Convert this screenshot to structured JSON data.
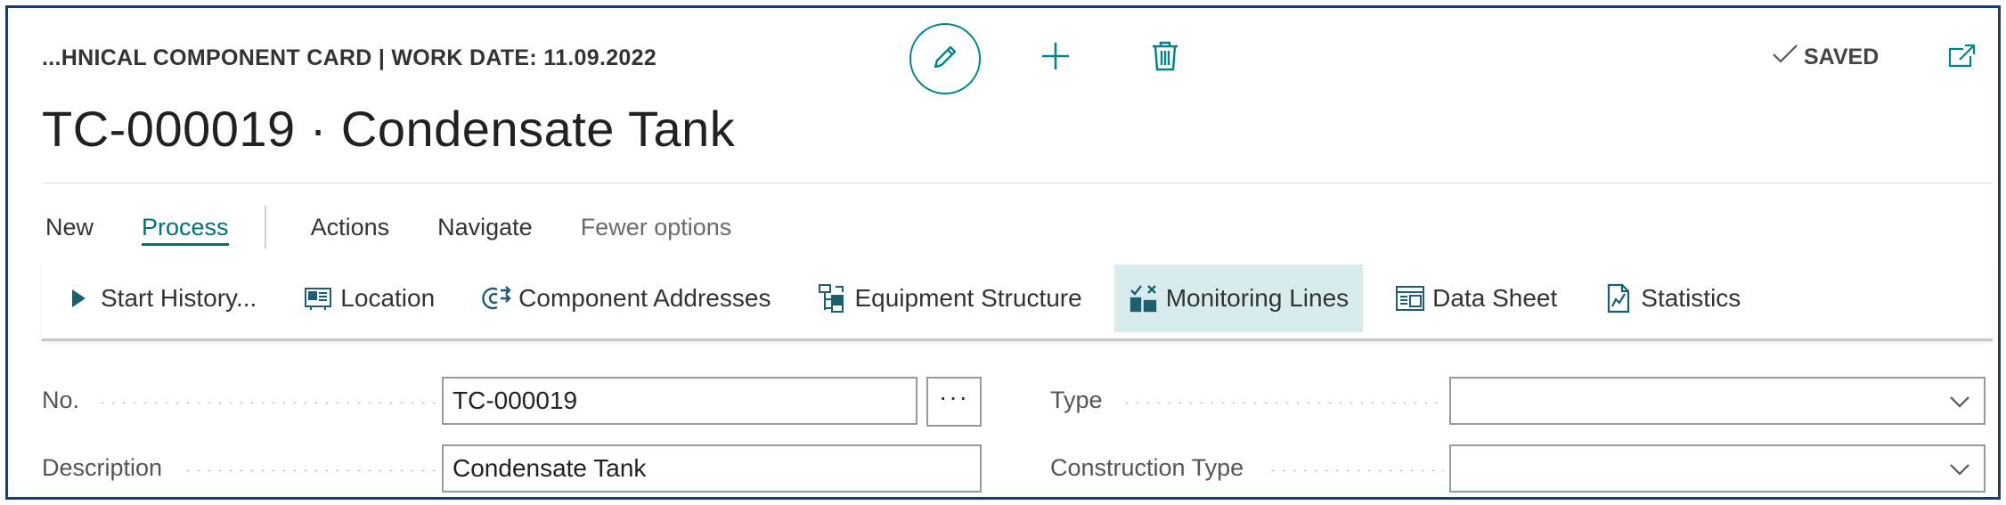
{
  "header": {
    "caption": "...HNICAL COMPONENT CARD | WORK DATE: 11.09.2022",
    "title": "TC-000019 · Condensate Tank",
    "saved_label": "SAVED"
  },
  "icons": {
    "edit": "pencil-icon",
    "new": "plus-icon",
    "delete": "trash-icon",
    "saved": "checkmark-icon",
    "popout": "open-in-new-window-icon"
  },
  "menu": {
    "items": [
      {
        "label": "New"
      },
      {
        "label": "Process"
      },
      {
        "label": "Actions"
      },
      {
        "label": "Navigate"
      },
      {
        "label": "Fewer options"
      }
    ]
  },
  "subbar": {
    "items": [
      {
        "label": "Start History...",
        "icon": "play-icon"
      },
      {
        "label": "Location",
        "icon": "location-card-icon"
      },
      {
        "label": "Component Addresses",
        "icon": "addresses-icon"
      },
      {
        "label": "Equipment Structure",
        "icon": "structure-icon"
      },
      {
        "label": "Monitoring Lines",
        "icon": "monitoring-lines-icon"
      },
      {
        "label": "Data Sheet",
        "icon": "data-sheet-icon"
      },
      {
        "label": "Statistics",
        "icon": "statistics-icon"
      }
    ]
  },
  "form": {
    "no_label": "No.",
    "no_value": "TC-000019",
    "lookup_label": "···",
    "description_label": "Description",
    "description_value": "Condensate Tank",
    "type_label": "Type",
    "type_value": "",
    "construction_type_label": "Construction Type",
    "construction_type_value": ""
  },
  "colors": {
    "accent": "#00707a",
    "highlight": "#d8ecee",
    "frame": "#1f3b6b"
  }
}
